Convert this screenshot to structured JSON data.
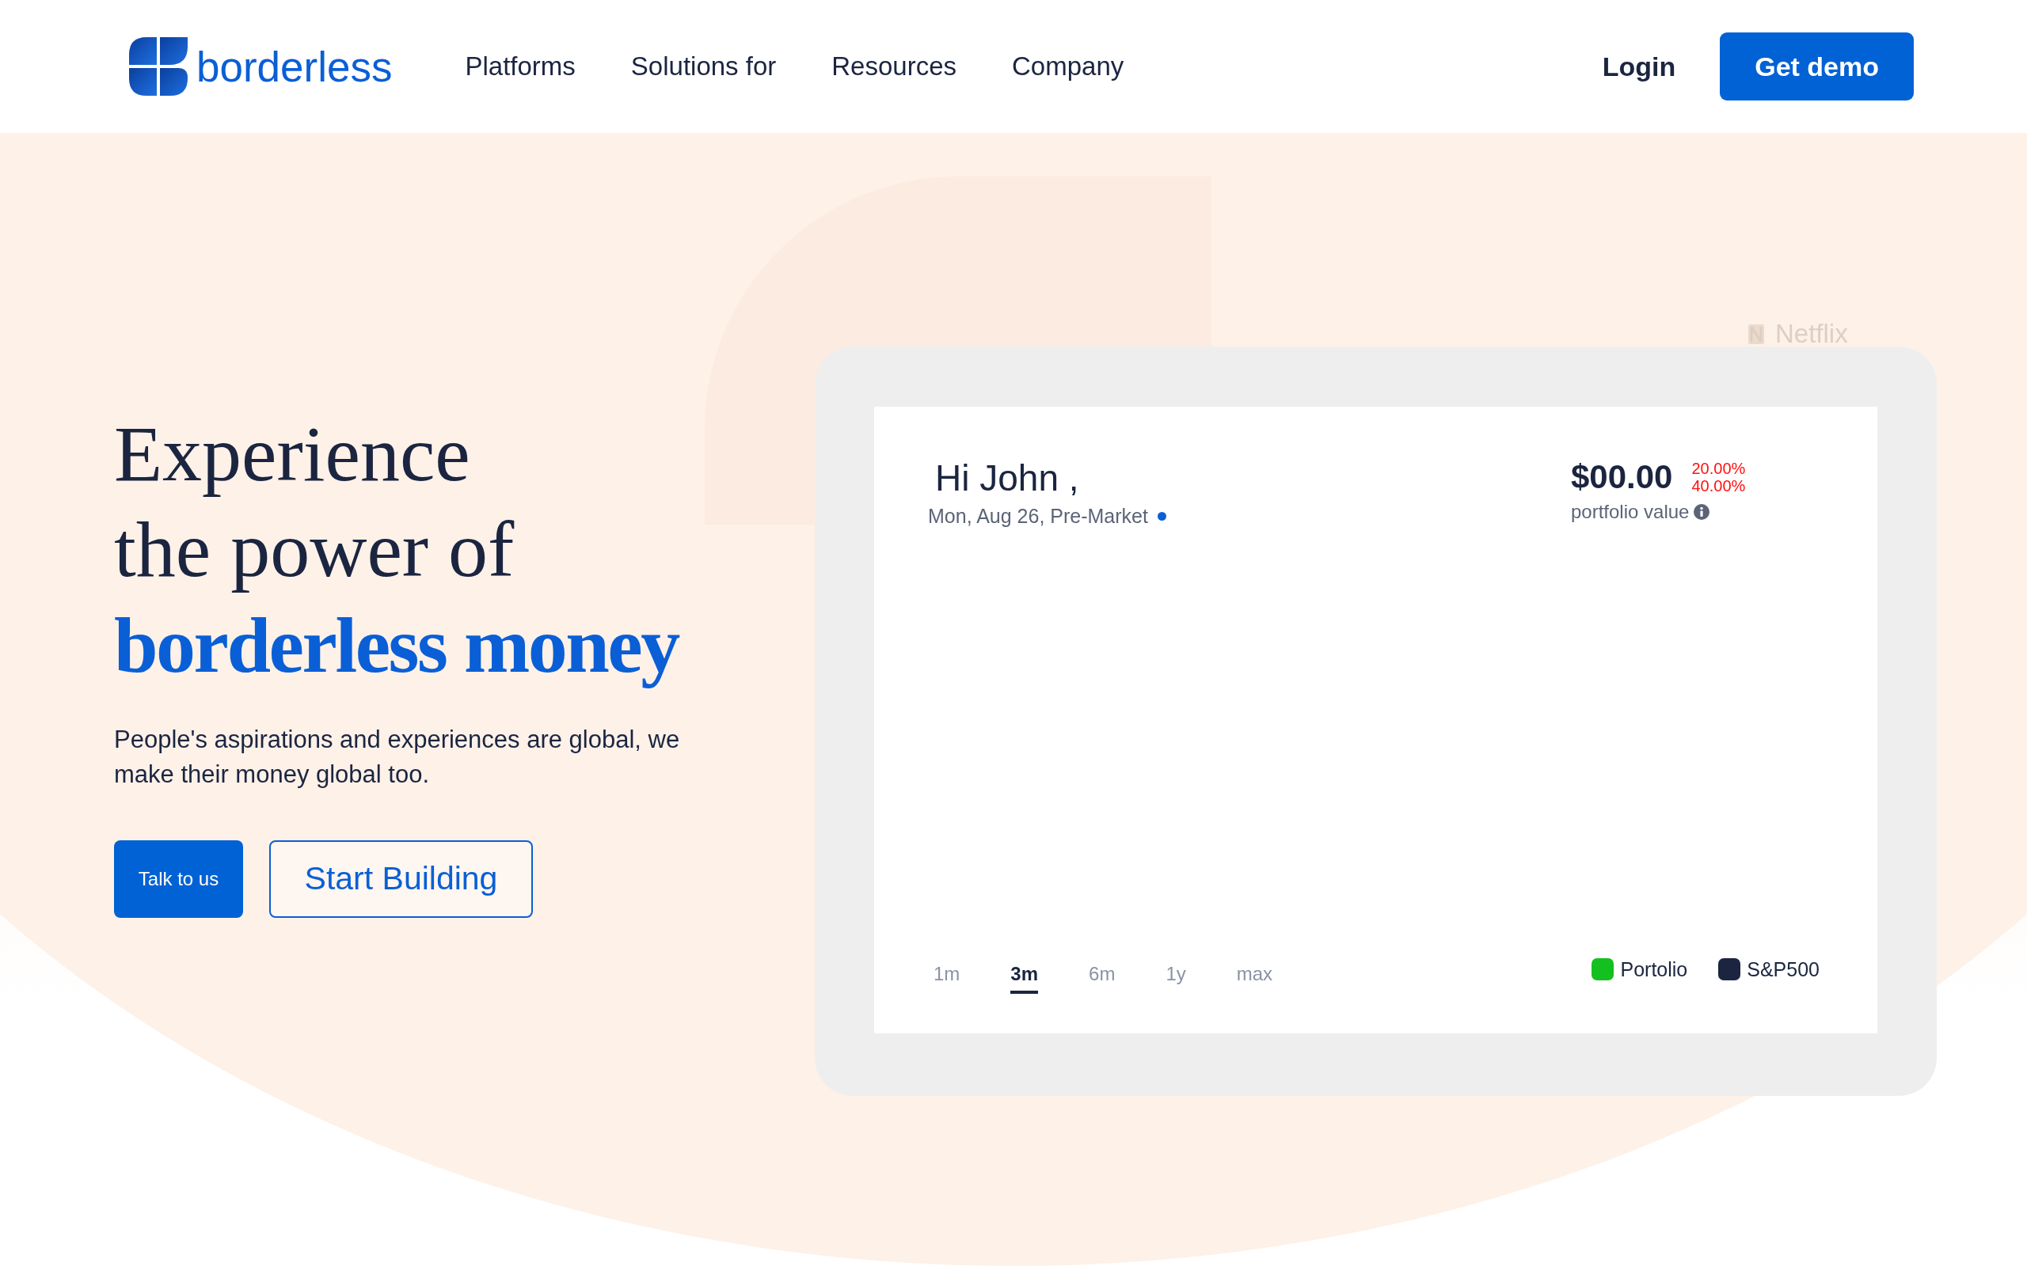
{
  "navbar": {
    "brand": "borderless",
    "links": [
      {
        "label": "Platforms"
      },
      {
        "label": "Solutions for"
      },
      {
        "label": "Resources"
      },
      {
        "label": "Company"
      }
    ],
    "login": "Login",
    "cta": "Get demo"
  },
  "hero": {
    "headline": [
      {
        "text": "Experience",
        "kind": "plain"
      },
      {
        "text": "the power of",
        "kind": "plain"
      },
      {
        "text": "borderless money",
        "kind": "accent"
      }
    ],
    "description": "People's aspirations and experiences are global, we make their money global too.",
    "buttons": [
      {
        "label": "Talk to us",
        "kind": "primary"
      },
      {
        "label": "Start Building",
        "kind": "outline"
      }
    ]
  },
  "background_widget": {
    "title": "Netflix"
  },
  "dashboard": {
    "greeting": "Hi John ,",
    "date_line": "Mon, Aug 26, Pre-Market",
    "portfolio": {
      "value": "$00.00",
      "changes": [
        "20.00%",
        "40.00%"
      ],
      "label": "portfolio value"
    },
    "ranges": [
      {
        "label": "1m",
        "selected": false
      },
      {
        "label": "3m",
        "selected": true
      },
      {
        "label": "6m",
        "selected": false
      },
      {
        "label": "1y",
        "selected": false
      },
      {
        "label": "max",
        "selected": false
      }
    ],
    "legend": [
      {
        "label": "Portolio",
        "color": "#14c01f"
      },
      {
        "label": "S&P500",
        "color": "#1b2540"
      }
    ]
  }
}
